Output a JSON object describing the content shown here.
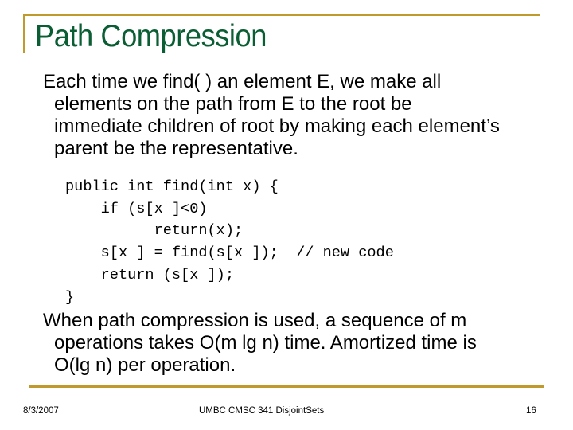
{
  "slide": {
    "title": "Path Compression",
    "accent_color": "#c09a2c",
    "title_color": "#0b5e34",
    "paragraph1": {
      "lines": [
        "Each time we find( ) an element E, we make all",
        "elements on the path from E to the root be",
        "immediate children of root by making each element’s",
        "parent be the representative."
      ]
    },
    "code": {
      "lines": [
        "public int find(int x) {",
        "    if (s[x ]<0)",
        "          return(x);",
        "    s[x ] = find(s[x ]);  // new code",
        "    return (s[x ]);",
        "}"
      ]
    },
    "paragraph2": {
      "lines": [
        "When path compression is used, a sequence of m",
        "operations takes O(m lg n) time. Amortized time is",
        "O(lg n) per operation."
      ]
    },
    "footer": {
      "date": "8/3/2007",
      "center": "UMBC CMSC 341 DisjointSets",
      "page_number": "16"
    }
  }
}
